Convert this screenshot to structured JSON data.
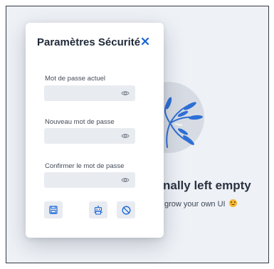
{
  "background": {
    "empty_title": "nally left empty",
    "empty_subtitle": "grow your own UI",
    "empty_subtitle_icon": "smiling-face-emoji"
  },
  "dialog": {
    "title": "Paramètres Sécurité",
    "close_icon": "close-icon",
    "fields": [
      {
        "label": "Mot de passe actuel",
        "value": "",
        "placeholder": "",
        "icon": "eye-icon"
      },
      {
        "label": "Nouveau mot de passe",
        "value": "",
        "placeholder": "",
        "icon": "eye-icon"
      },
      {
        "label": "Confirmer le mot de passe",
        "value": "",
        "placeholder": "",
        "icon": "eye-icon"
      }
    ],
    "actions": [
      {
        "name": "save",
        "icon": "floppy-disk-icon"
      },
      {
        "name": "password-generator",
        "icon": "robot-icon"
      },
      {
        "name": "cancel",
        "icon": "ban-icon"
      }
    ]
  },
  "colors": {
    "accent": "#1565d8",
    "dialog_bg": "#ffffff",
    "input_bg": "#e8ebf0",
    "page_bg": "#eef1f6",
    "leaf": "#2f6fd6"
  }
}
